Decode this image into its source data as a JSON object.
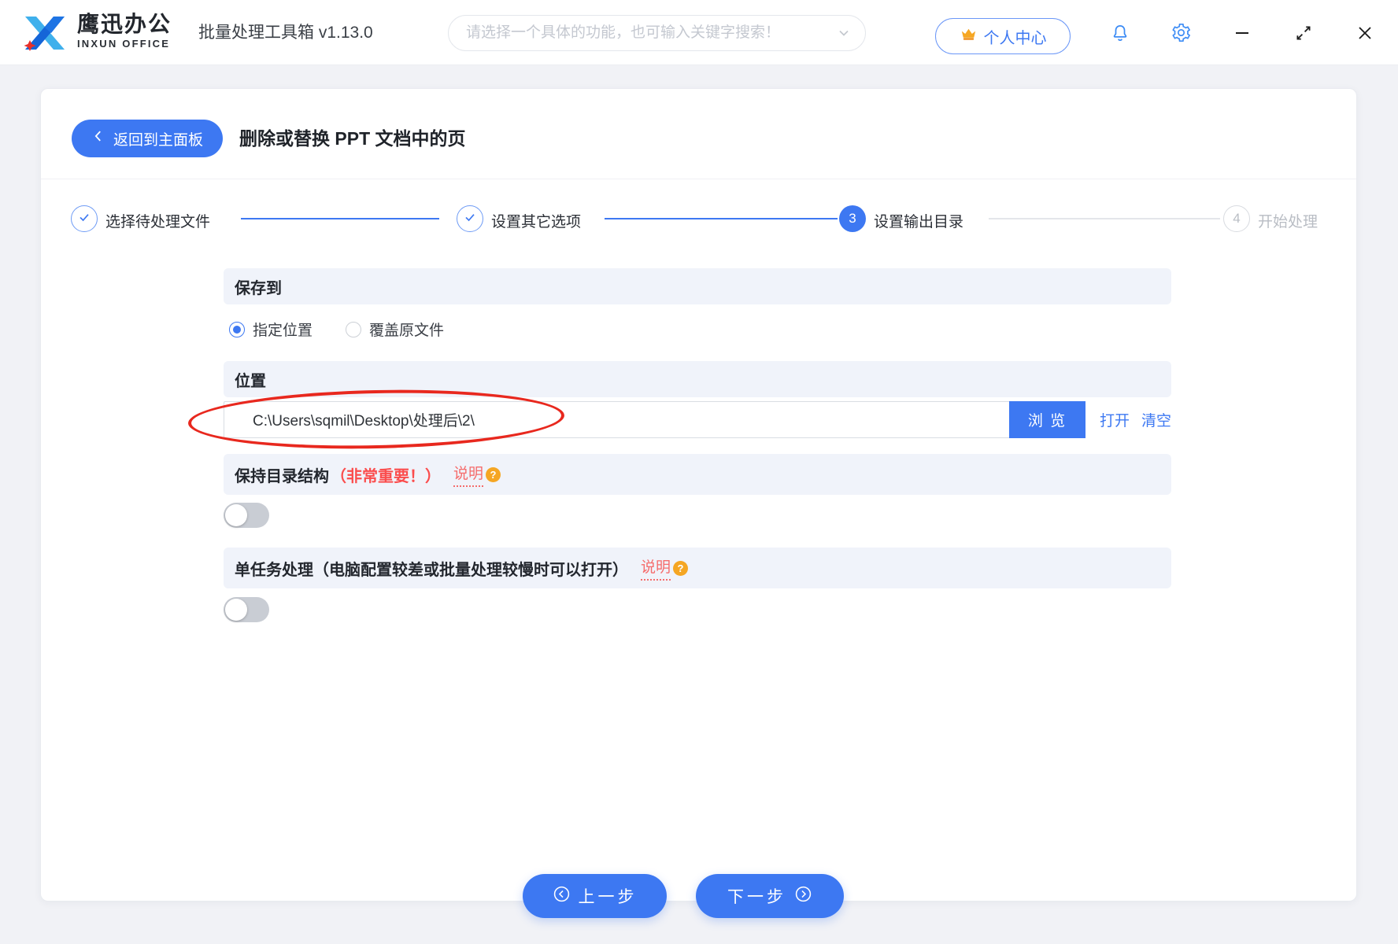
{
  "topbar": {
    "brand_cn": "鹰迅办公",
    "brand_en": "INXUN OFFICE",
    "app_title": "批量处理工具箱 v1.13.0",
    "search_placeholder": "请选择一个具体的功能，也可输入关键字搜索！",
    "user_center_label": "个人中心"
  },
  "header": {
    "back_label": "返回到主面板",
    "page_title": "删除或替换 PPT 文档中的页"
  },
  "steps": {
    "s1": {
      "label": "选择待处理文件",
      "state": "done"
    },
    "s2": {
      "label": "设置其它选项",
      "state": "done"
    },
    "s3": {
      "num": "3",
      "label": "设置输出目录",
      "state": "active"
    },
    "s4": {
      "num": "4",
      "label": "开始处理",
      "state": "pending"
    }
  },
  "save_to": {
    "title": "保存到",
    "radio_specified": "指定位置",
    "radio_specified_selected": true,
    "radio_overwrite": "覆盖原文件",
    "radio_overwrite_selected": false
  },
  "location": {
    "title": "位置",
    "path_value": "C:\\Users\\sqmil\\Desktop\\处理后\\2\\",
    "browse_label": "浏 览",
    "open_label": "打开",
    "clear_label": "清空"
  },
  "keep_structure": {
    "title": "保持目录结构",
    "warning": "（非常重要！）",
    "help_label": "说明",
    "help_badge": "?",
    "enabled": false
  },
  "single_task": {
    "title": "单任务处理（电脑配置较差或批量处理较慢时可以打开）",
    "help_label": "说明",
    "help_badge": "?",
    "enabled": false
  },
  "footer": {
    "prev_label": "上一步",
    "next_label": "下一步"
  },
  "colors": {
    "primary_blue": "#3d78f2",
    "bar_background": "#f0f3fa",
    "annotation_red": "#e8281e",
    "warning_red": "#fb4d4d",
    "help_red": "#f56c6c",
    "badge_orange": "#f5a623",
    "disabled_gray": "#b9bdc4"
  }
}
